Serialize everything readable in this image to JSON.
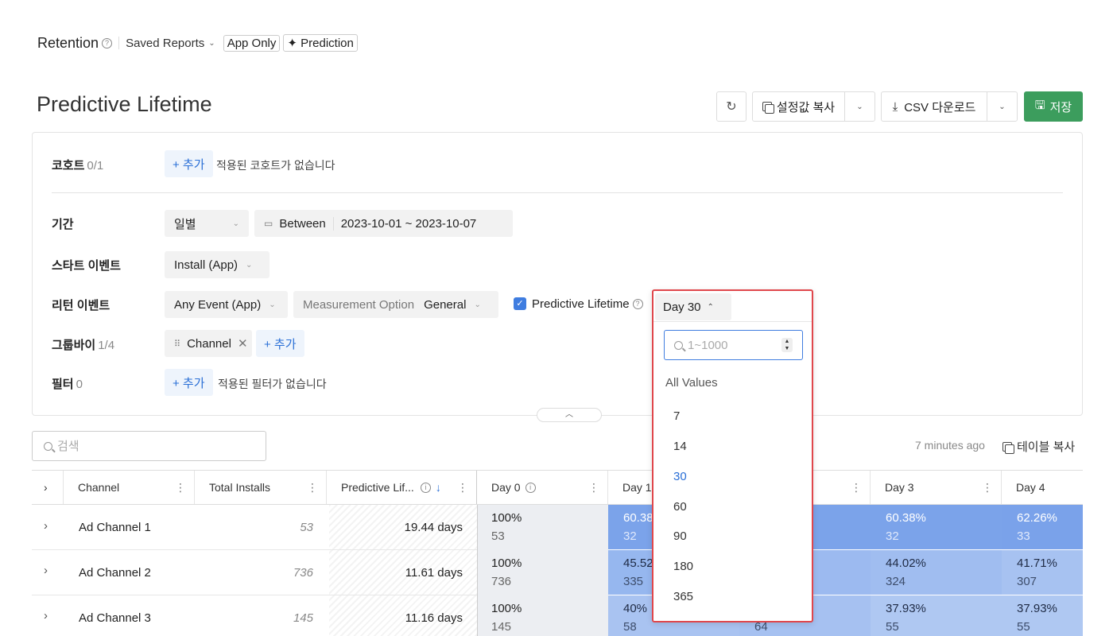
{
  "topbar": {
    "title": "Retention",
    "saved_reports": "Saved Reports",
    "tag_app_only": "App Only",
    "tag_prediction": "Prediction"
  },
  "header": {
    "page_title": "Predictive Lifetime",
    "copy_settings": "설정값 복사",
    "csv_download": "CSV 다운로드",
    "save": "저장"
  },
  "settings": {
    "cohort_label": "코호트",
    "cohort_count": "0/1",
    "cohort_add": "+ 추가",
    "cohort_hint": "적용된 코호트가 없습니다",
    "period_label": "기간",
    "period_unit": "일별",
    "period_between": "Between",
    "period_range": "2023-10-01 ~ 2023-10-07",
    "start_event_label": "스타트 이벤트",
    "start_event": "Install (App)",
    "return_event_label": "리턴 이벤트",
    "return_event": "Any Event (App)",
    "measurement_label": "Measurement Option",
    "measurement_value": "General",
    "predictive_lifetime_label": "Predictive Lifetime",
    "groupby_label": "그룹바이",
    "groupby_count": "1/4",
    "groupby_chip": "Channel",
    "groupby_add": "+ 추가",
    "filter_label": "필터",
    "filter_count": "0",
    "filter_add": "+ 추가",
    "filter_hint": "적용된 필터가 없습니다"
  },
  "dropdown": {
    "selected": "Day 30",
    "input_placeholder": "1~1000",
    "all_values": "All Values",
    "options": [
      "7",
      "14",
      "30",
      "60",
      "90",
      "180",
      "365"
    ],
    "selected_option": "30"
  },
  "table_toolbar": {
    "search_placeholder": "검색",
    "updated": "7 minutes ago",
    "copy_table": "테이블 복사"
  },
  "table": {
    "headers": {
      "channel": "Channel",
      "total_installs": "Total Installs",
      "predictive": "Predictive Lif...",
      "day0": "Day 0",
      "day1": "Day 1",
      "day3": "Day 3",
      "day4": "Day 4"
    },
    "rows": [
      {
        "channel": "Ad Channel 1",
        "installs": "53",
        "lifetime": "19.44 days",
        "d0_pct": "100%",
        "d0_n": "53",
        "d1_pct": "60.38",
        "d1_n": "32",
        "d2_n": "",
        "d3_pct": "60.38%",
        "d3_n": "32",
        "d4_pct": "62.26%",
        "d4_n": "33"
      },
      {
        "channel": "Ad Channel 2",
        "installs": "736",
        "lifetime": "11.61 days",
        "d0_pct": "100%",
        "d0_n": "736",
        "d1_pct": "45.52",
        "d1_n": "335",
        "d2_n": "",
        "d3_pct": "44.02%",
        "d3_n": "324",
        "d4_pct": "41.71%",
        "d4_n": "307"
      },
      {
        "channel": "Ad Channel 3",
        "installs": "145",
        "lifetime": "11.16 days",
        "d0_pct": "100%",
        "d0_n": "145",
        "d1_pct": "40%",
        "d1_n": "58",
        "d2_n": "64",
        "d3_pct": "37.93%",
        "d3_n": "55",
        "d4_pct": "37.93%",
        "d4_n": "55"
      }
    ]
  },
  "colors": {
    "accent_blue": "#2a6fd6",
    "save_green": "#3c9d5d",
    "dropdown_highlight": "#e0474c",
    "heat_strong": "#7ba3ea",
    "heat_light": "#a9c3f1"
  }
}
